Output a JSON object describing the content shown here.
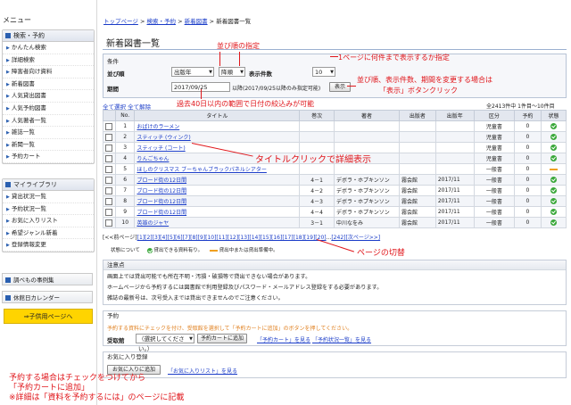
{
  "sidebar": {
    "menu_title": "メニュー",
    "group1": {
      "title": "検索・予約",
      "items": [
        "かんたん検索",
        "詳細検索",
        "障害者向け資料",
        "新着図書",
        "人気貸出図書",
        "人気予約図書",
        "人気著者一覧",
        "雑誌一覧",
        "新聞一覧",
        "予約カート"
      ]
    },
    "group2": {
      "title": "マイライブラリ",
      "items": [
        "貸出状況一覧",
        "予約状況一覧",
        "お気に入りリスト",
        "希望ジャンル新着",
        "登録情報変更"
      ]
    },
    "faq": "調べもの事例集",
    "calendar": "休館日カレンダー",
    "child_link": "⇒子供用ページへ"
  },
  "breadcrumb": {
    "top": "トップページ",
    "search": "検索・予約",
    "newbooks": "新着図書",
    "current": "新着図書一覧",
    "sep": ">"
  },
  "page_title": "新着図書一覧",
  "conditions": {
    "title": "条件",
    "sort_label": "並び順",
    "sort_value": "出版年",
    "order_value": "降順",
    "count_label": "表示件数",
    "count_value": "10",
    "period_label": "期間",
    "period_value": "2017/09/25",
    "period_note": "以降(2017/09/25以降のみ指定可能)",
    "display_button": "表示"
  },
  "links": {
    "select_all": "全て選択",
    "deselect_all": "全て解除"
  },
  "result_summary": "全2413件中 1件目～10件目",
  "table": {
    "headers": [
      "No.",
      "タイトル",
      "巻次",
      "著者",
      "出版者",
      "出版年",
      "区分",
      "予約",
      "状態"
    ],
    "rows": [
      {
        "no": "1",
        "title": "おばけのラーメン",
        "vol": "",
        "author": "",
        "publisher": "",
        "year": "",
        "cat": "児童書",
        "reserve": "0",
        "status": "ok"
      },
      {
        "no": "2",
        "title": "スティッチ (ウィンク)",
        "vol": "",
        "author": "",
        "publisher": "",
        "year": "",
        "cat": "児童書",
        "reserve": "0",
        "status": "ok"
      },
      {
        "no": "3",
        "title": "スティッチ (コート)",
        "vol": "",
        "author": "",
        "publisher": "",
        "year": "",
        "cat": "児童書",
        "reserve": "0",
        "status": "ok"
      },
      {
        "no": "4",
        "title": "りんごちゃん",
        "vol": "",
        "author": "",
        "publisher": "",
        "year": "",
        "cat": "児童書",
        "reserve": "0",
        "status": "ok"
      },
      {
        "no": "5",
        "title": "ほしのクリスマス ブーちゃんブラックパネルシアター",
        "vol": "",
        "author": "",
        "publisher": "",
        "year": "",
        "cat": "一般書",
        "reserve": "0",
        "status": "wait"
      },
      {
        "no": "6",
        "title": "ブロード街の12日間",
        "vol": "4－1",
        "author": "デボラ・ホプキンソン",
        "publisher": "霧会館",
        "year": "2017/11",
        "cat": "一般書",
        "reserve": "0",
        "status": "ok"
      },
      {
        "no": "7",
        "title": "ブロード街の12日間",
        "vol": "4－2",
        "author": "デボラ・ホプキンソン",
        "publisher": "霧会館",
        "year": "2017/11",
        "cat": "一般書",
        "reserve": "0",
        "status": "ok"
      },
      {
        "no": "8",
        "title": "ブロード街の12日間",
        "vol": "4－3",
        "author": "デボラ・ホプキンソン",
        "publisher": "霧会館",
        "year": "2017/11",
        "cat": "一般書",
        "reserve": "0",
        "status": "ok"
      },
      {
        "no": "9",
        "title": "ブロード街の12日間",
        "vol": "4－4",
        "author": "デボラ・ホプキンソン",
        "publisher": "霧会館",
        "year": "2017/11",
        "cat": "一般書",
        "reserve": "0",
        "status": "ok"
      },
      {
        "no": "10",
        "title": "英雄のジャヤ",
        "vol": "3－1",
        "author": "中川なをみ",
        "publisher": "霧会館",
        "year": "2017/11",
        "cat": "一般書",
        "reserve": "0",
        "status": "ok"
      }
    ]
  },
  "pager": {
    "prev": "[<<前ページ]",
    "pages": "[1][2][3][4][5][6][7][8][9][10][11][12][13][14][15][16][17][18][19][20]",
    "ellipsis": "...",
    "last": "[242]",
    "next": "[次ページ>>]"
  },
  "legend": {
    "label": "状態について",
    "ok": "貸出できる資料有り。",
    "wait": "貸出中または貸出準備中。"
  },
  "notice": {
    "title": "注意点",
    "lines": [
      "画面上では貸出可能でも所在不明・汚損・破損等で貸出できない場合があります。",
      "ホームページから予約するには図書館で利用登録及びパスワード・メールアドレス登録をする必要があります。",
      "雑誌の最新号は、次号受入までは貸出できませんのでご注意ください。"
    ]
  },
  "reserve": {
    "title": "予約",
    "instruction": "予約する資料にチェックを付け、受取館を選択して「予約カートに追加」のボタンを押してください。",
    "pickup_label": "受取館",
    "pickup_value": "（選択してください。）",
    "add_button": "予約カートに追加",
    "cart_link": "「予約カート」を見る",
    "status_link": "「予約状況一覧」を見る"
  },
  "favorites": {
    "title": "お気に入り登録",
    "add_button": "お気に入りに追加",
    "view_link": "「お気に入りリスト」を見る"
  },
  "annotations": {
    "sort": "並び順の指定",
    "per_page": "1ページに何件まで表示するか指定",
    "change": "並び順、表示件数、期間を変更する場合は",
    "change2": "「表示」ボタンクリック",
    "period": "過去40日以内の範囲で日付の絞込みが可能",
    "title_click": "タイトルクリックで詳細表示",
    "page_switch": "ページの切替",
    "reserve1": "予約する場合はチェックをつけてから",
    "reserve2": "「予約カートに追加」",
    "reserve3": "※詳細は「資料を予約するには」のページに記載"
  },
  "colors": {
    "annotation": "#e0161b",
    "link": "#1a3cc8",
    "ok": "#3aa83a",
    "wait": "#f0a020",
    "child_button": "#ffd400"
  }
}
